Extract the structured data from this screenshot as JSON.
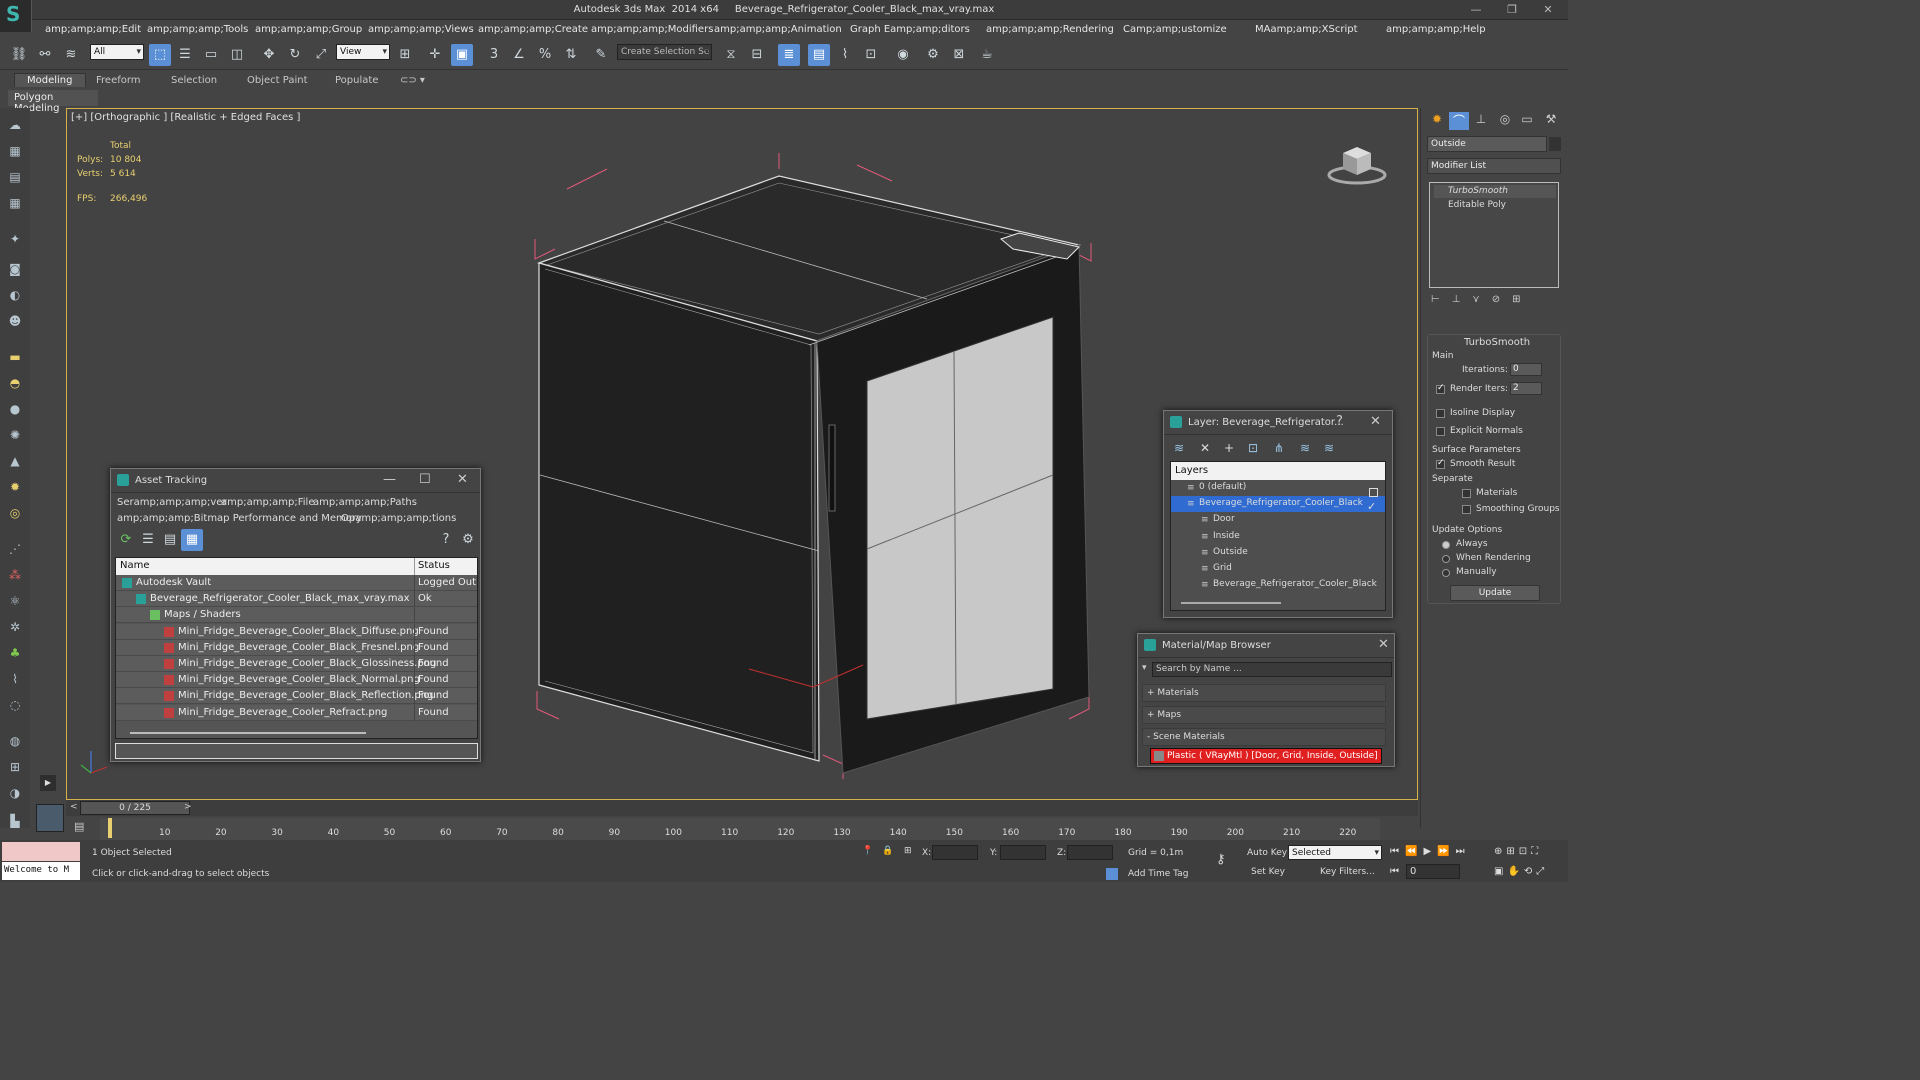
{
  "window": {
    "title": "Autodesk 3ds Max  2014 x64     Beverage_Refrigerator_Cooler_Black_max_vray.max"
  },
  "menu": [
    "amp;amp;amp;Edit",
    "amp;amp;amp;Tools",
    "amp;amp;amp;Group",
    "amp;amp;amp;Views",
    "amp;amp;amp;Create",
    "amp;amp;amp;Modifiers",
    "amp;amp;amp;Animation",
    "Graph Eamp;amp;ditors",
    "amp;amp;amp;Rendering",
    "Camp;amp;ustomize",
    "MAamp;amp;XScript",
    "amp;amp;amp;Help"
  ],
  "toolbar": {
    "filter": "All",
    "refcoord": "View",
    "selset": "Create Selection Se"
  },
  "ribbon": {
    "tabs": [
      "Modeling",
      "Freeform",
      "Selection",
      "Object Paint",
      "Populate"
    ],
    "sub": "Polygon Modeling"
  },
  "viewport": {
    "label": "[+] [Orthographic ] [Realistic + Edged Faces ]",
    "stats_header": "Total",
    "polys_label": "Polys:",
    "polys": "10 804",
    "verts_label": "Verts:",
    "verts": "5 614",
    "fps_label": "FPS:",
    "fps": "266,496"
  },
  "cmdpanel": {
    "name": "Outside",
    "modlist": "Modifier List",
    "stack": [
      "TurboSmooth",
      "Editable Poly"
    ],
    "rollout_title": "TurboSmooth",
    "main_label": "Main",
    "iterations_label": "Iterations:",
    "iterations": "0",
    "render_iters_label": "Render Iters:",
    "render_iters": "2",
    "isoline": "Isoline Display",
    "explicit": "Explicit Normals",
    "surface": "Surface Parameters",
    "smooth_result": "Smooth Result",
    "separate": "Separate",
    "materials": "Materials",
    "smoothing_groups": "Smoothing Groups",
    "update_options": "Update Options",
    "always": "Always",
    "when_rendering": "When Rendering",
    "manually": "Manually",
    "update_btn": "Update"
  },
  "asset": {
    "title": "Asset Tracking",
    "menu": [
      "Seramp;amp;amp;ver",
      "amp;amp;amp;File",
      "amp;amp;amp;Paths",
      "amp;amp;amp;Bitmap Performance and Memory",
      "Opamp;amp;amp;tions"
    ],
    "col_name": "Name",
    "col_status": "Status",
    "rows": [
      {
        "name": "Autodesk Vault",
        "status": "Logged Out ..",
        "indent": 20
      },
      {
        "name": "Beverage_Refrigerator_Cooler_Black_max_vray.max",
        "status": "Ok",
        "indent": 34
      },
      {
        "name": "Maps / Shaders",
        "status": "",
        "indent": 48
      },
      {
        "name": "Mini_Fridge_Beverage_Cooler_Black_Diffuse.png",
        "status": "Found",
        "indent": 62
      },
      {
        "name": "Mini_Fridge_Beverage_Cooler_Black_Fresnel.png",
        "status": "Found",
        "indent": 62
      },
      {
        "name": "Mini_Fridge_Beverage_Cooler_Black_Glossiness.png",
        "status": "Found",
        "indent": 62
      },
      {
        "name": "Mini_Fridge_Beverage_Cooler_Black_Normal.png",
        "status": "Found",
        "indent": 62
      },
      {
        "name": "Mini_Fridge_Beverage_Cooler_Black_Reflection.png",
        "status": "Found",
        "indent": 62
      },
      {
        "name": "Mini_Fridge_Beverage_Cooler_Refract.png",
        "status": "Found",
        "indent": 62
      }
    ]
  },
  "layer": {
    "title": "Layer: Beverage_Refrigerator...",
    "help": "?",
    "header": "Layers",
    "items": [
      {
        "label": "0 (default)",
        "indent": 16,
        "sel": false
      },
      {
        "label": "Beverage_Refrigerator_Cooler_Black",
        "indent": 16,
        "sel": true
      },
      {
        "label": "Door",
        "indent": 30,
        "sel": false
      },
      {
        "label": "Inside",
        "indent": 30,
        "sel": false
      },
      {
        "label": "Outside",
        "indent": 30,
        "sel": false
      },
      {
        "label": "Grid",
        "indent": 30,
        "sel": false
      },
      {
        "label": "Beverage_Refrigerator_Cooler_Black",
        "indent": 30,
        "sel": false
      }
    ]
  },
  "matbrowser": {
    "title": "Material/Map Browser",
    "search": "Search by Name ...",
    "materials": "+ Materials",
    "maps": "+ Maps",
    "scene": "- Scene Materials",
    "item": "Plastic ( VRayMtl ) [Door, Grid, Inside, Outside]"
  },
  "timeline": {
    "frame": "0 / 225",
    "ticks": [
      "10",
      "20",
      "30",
      "40",
      "50",
      "60",
      "70",
      "80",
      "90",
      "100",
      "110",
      "120",
      "130",
      "140",
      "150",
      "160",
      "170",
      "180",
      "190",
      "200",
      "210",
      "220"
    ]
  },
  "status": {
    "welcome": "Welcome to M",
    "selected": "1 Object Selected",
    "prompt": "Click or click-and-drag to select objects",
    "x": "X:",
    "y": "Y:",
    "z": "Z:",
    "grid": "Grid = 0,1m",
    "autokey": "Auto Key",
    "setkey": "Set Key",
    "selected_drop": "Selected",
    "keyfilters": "Key Filters...",
    "addtimetag": "Add Time Tag",
    "frame": "0"
  }
}
